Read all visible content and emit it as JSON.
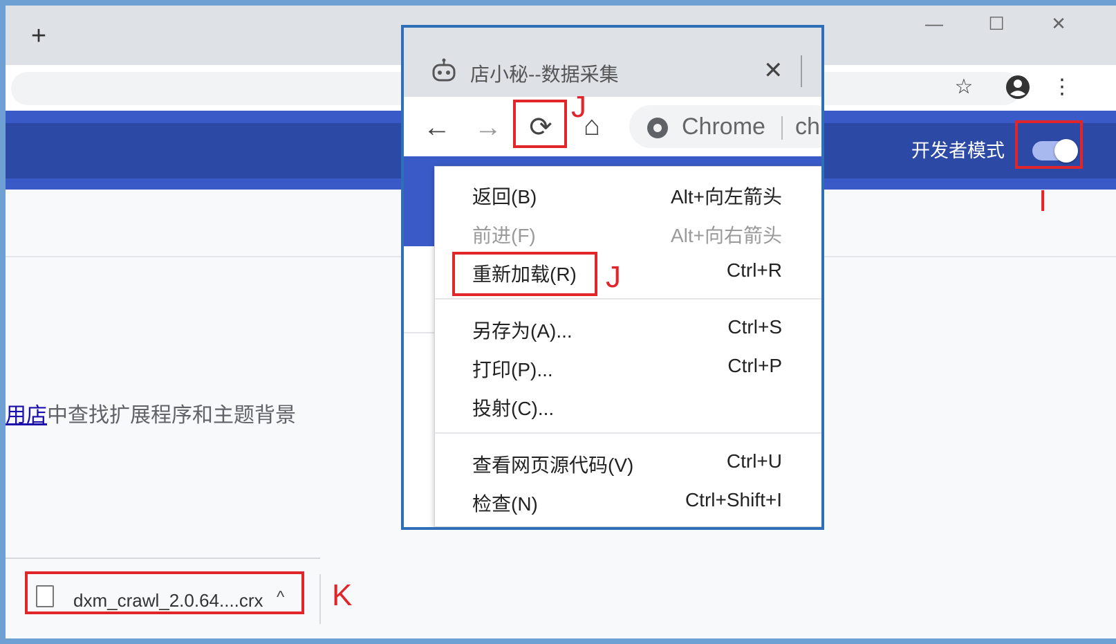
{
  "background_browser": {
    "new_tab_label": "+",
    "window_controls": {
      "minimize": "—",
      "maximize": "☐",
      "close": "✕"
    },
    "toolbar_icons": {
      "star": "☆",
      "menu": "⋮"
    },
    "header": {
      "developer_mode_label": "开发者模式",
      "developer_mode_on": true
    },
    "store_line": {
      "link_text": "用店",
      "rest_text": "中查找扩展程序和主题背景"
    },
    "download_shelf": {
      "filename": "dxm_crawl_2.0.64....crx",
      "chevron": "^"
    }
  },
  "inset": {
    "tab_title": "店小秘--数据采集",
    "tab_close": "✕",
    "nav": {
      "back": "←",
      "forward": "→",
      "reload": "⟳",
      "home": "⌂"
    },
    "omnibox": {
      "site_label": "Chrome",
      "url_fragment": "ch"
    },
    "context_menu": {
      "items": [
        {
          "label": "返回(B)",
          "shortcut": "Alt+向左箭头",
          "enabled": true
        },
        {
          "label": "前进(F)",
          "shortcut": "Alt+向右箭头",
          "enabled": false
        },
        {
          "label": "重新加载(R)",
          "shortcut": "Ctrl+R",
          "enabled": true
        },
        {
          "label": "另存为(A)...",
          "shortcut": "Ctrl+S",
          "enabled": true
        },
        {
          "label": "打印(P)...",
          "shortcut": "Ctrl+P",
          "enabled": true
        },
        {
          "label": "投射(C)...",
          "shortcut": "",
          "enabled": true
        },
        {
          "label": "查看网页源代码(V)",
          "shortcut": "Ctrl+U",
          "enabled": true
        },
        {
          "label": "检查(N)",
          "shortcut": "Ctrl+Shift+I",
          "enabled": true
        }
      ]
    }
  },
  "annotations": {
    "label_i": "I",
    "label_j_reload": "J",
    "label_j_menu": "J",
    "label_k": "K",
    "color": "#e0262b"
  }
}
